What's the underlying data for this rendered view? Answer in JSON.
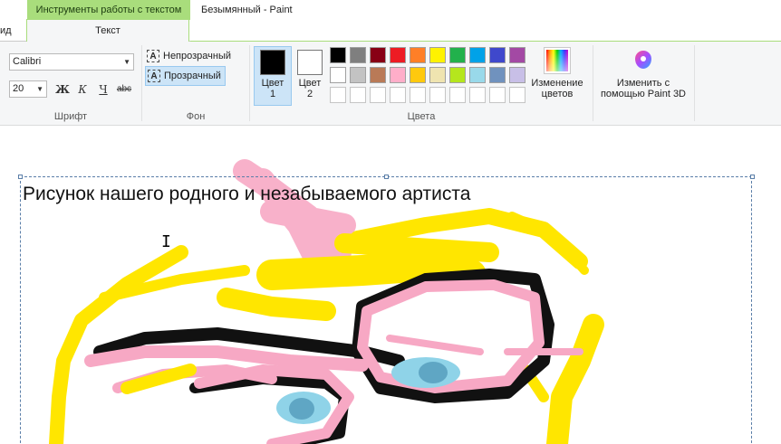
{
  "window": {
    "context_tab": "Инструменты работы с текстом",
    "title": "Безымянный - Paint"
  },
  "tabs": {
    "view_partial": "ид",
    "text": "Текст"
  },
  "font_group": {
    "label": "Шрифт",
    "font_name": "Calibri",
    "font_size": "20",
    "bold": "Ж",
    "italic": "К",
    "underline": "Ч",
    "strike": "abc"
  },
  "background_group": {
    "label": "Фон",
    "opaque": "Непрозрачный",
    "transparent": "Прозрачный",
    "selected": "Прозрачный"
  },
  "colors_group": {
    "label": "Цвета",
    "color1": {
      "label": "Цвет 1",
      "line1": "Цвет",
      "line2": "1",
      "color": "#000000"
    },
    "color2": {
      "label": "Цвет 2",
      "line1": "Цвет",
      "line2": "2",
      "color": "#ffffff"
    },
    "palette_row1": [
      "#000000",
      "#7f7f7f",
      "#880015",
      "#ed1c24",
      "#ff7f27",
      "#fff200",
      "#22b14c",
      "#00a2e8",
      "#3f48cc",
      "#a349a4"
    ],
    "palette_row2": [
      "#ffffff",
      "#c3c3c3",
      "#b97a57",
      "#ffaec9",
      "#ffc90e",
      "#efe4b0",
      "#b5e61d",
      "#99d9ea",
      "#7092be",
      "#c8bfe7"
    ],
    "edit_colors": {
      "line1": "Изменение",
      "line2": "цветов"
    }
  },
  "paint3d": {
    "line1": "Изменить с",
    "line2": "помощью Paint 3D"
  },
  "canvas": {
    "text": "Рисунок нашего родного и незабываемого артиста"
  }
}
